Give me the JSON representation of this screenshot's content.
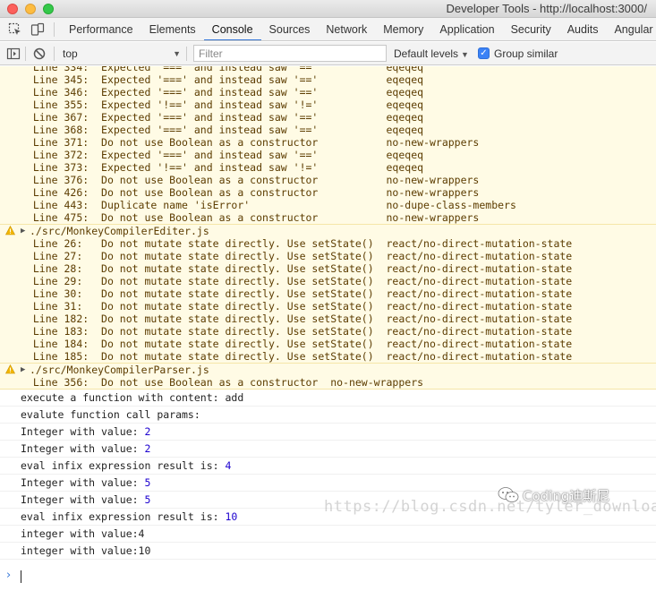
{
  "window": {
    "title": "Developer Tools - http://localhost:3000/"
  },
  "tabs": [
    {
      "label": "Performance",
      "active": false
    },
    {
      "label": "Elements",
      "active": false
    },
    {
      "label": "Console",
      "active": true
    },
    {
      "label": "Sources",
      "active": false
    },
    {
      "label": "Network",
      "active": false
    },
    {
      "label": "Memory",
      "active": false
    },
    {
      "label": "Application",
      "active": false
    },
    {
      "label": "Security",
      "active": false
    },
    {
      "label": "Audits",
      "active": false
    },
    {
      "label": "Angular",
      "active": false
    }
  ],
  "toolbar": {
    "context": "top",
    "filter_placeholder": "Filter",
    "levels": "Default levels",
    "group_similar": "Group similar",
    "group_similar_checked": true
  },
  "warnings": [
    {
      "file": "",
      "lines": [
        "Line 334:  Expected '===' and instead saw '=='           eqeqeq",
        "Line 345:  Expected '===' and instead saw '=='           eqeqeq",
        "Line 346:  Expected '===' and instead saw '=='           eqeqeq",
        "Line 355:  Expected '!==' and instead saw '!='           eqeqeq",
        "Line 367:  Expected '===' and instead saw '=='           eqeqeq",
        "Line 368:  Expected '===' and instead saw '=='           eqeqeq",
        "Line 371:  Do not use Boolean as a constructor           no-new-wrappers",
        "Line 372:  Expected '===' and instead saw '=='           eqeqeq",
        "Line 373:  Expected '!==' and instead saw '!='           eqeqeq",
        "Line 376:  Do not use Boolean as a constructor           no-new-wrappers",
        "Line 426:  Do not use Boolean as a constructor           no-new-wrappers",
        "Line 443:  Duplicate name 'isError'                      no-dupe-class-members",
        "Line 475:  Do not use Boolean as a constructor           no-new-wrappers"
      ]
    },
    {
      "file": "./src/MonkeyCompilerEditer.js",
      "lines": [
        "Line 26:   Do not mutate state directly. Use setState()  react/no-direct-mutation-state",
        "Line 27:   Do not mutate state directly. Use setState()  react/no-direct-mutation-state",
        "Line 28:   Do not mutate state directly. Use setState()  react/no-direct-mutation-state",
        "Line 29:   Do not mutate state directly. Use setState()  react/no-direct-mutation-state",
        "Line 30:   Do not mutate state directly. Use setState()  react/no-direct-mutation-state",
        "Line 31:   Do not mutate state directly. Use setState()  react/no-direct-mutation-state",
        "Line 182:  Do not mutate state directly. Use setState()  react/no-direct-mutation-state",
        "Line 183:  Do not mutate state directly. Use setState()  react/no-direct-mutation-state",
        "Line 184:  Do not mutate state directly. Use setState()  react/no-direct-mutation-state",
        "Line 185:  Do not mutate state directly. Use setState()  react/no-direct-mutation-state"
      ]
    },
    {
      "file": "./src/MonkeyCompilerParser.js",
      "lines": [
        "Line 356:  Do not use Boolean as a constructor  no-new-wrappers"
      ]
    }
  ],
  "logs": [
    {
      "text": "execute a function with content: add",
      "num": ""
    },
    {
      "text": "evalute function call params:",
      "num": ""
    },
    {
      "text": "Integer with value: ",
      "num": "2"
    },
    {
      "text": "Integer with value: ",
      "num": "2"
    },
    {
      "text": "eval infix expression result is: ",
      "num": "4"
    },
    {
      "text": "Integer with value: ",
      "num": "5"
    },
    {
      "text": "Integer with value: ",
      "num": "5"
    },
    {
      "text": "eval infix expression result is: ",
      "num": "10"
    },
    {
      "text": "integer with value:4",
      "num": ""
    },
    {
      "text": "integer with value:10",
      "num": ""
    }
  ],
  "watermark": {
    "brand": "Coding迪斯尼",
    "url": "https://blog.csdn.net/tyler_download"
  }
}
